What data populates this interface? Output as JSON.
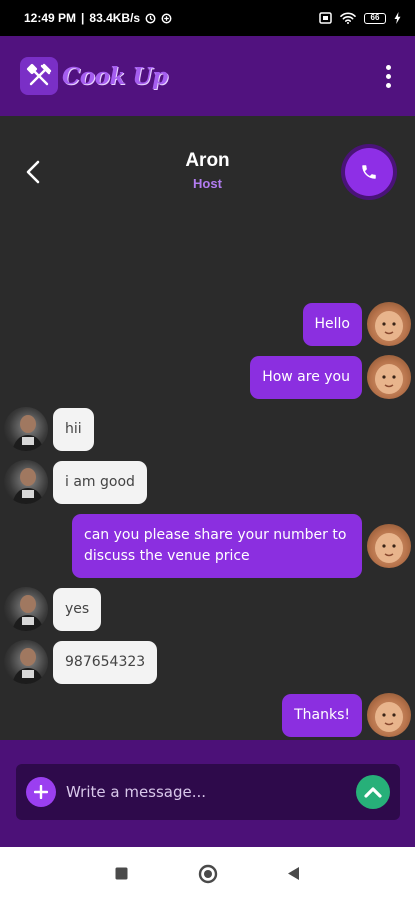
{
  "status_bar": {
    "time": "12:49 PM",
    "speed": "83.4KB/s",
    "battery": "66"
  },
  "app_bar": {
    "brand_name": "Cook Up",
    "menu_icon": "kebab-menu-icon"
  },
  "chat_header": {
    "contact_name": "Aron",
    "contact_role": "Host",
    "back_icon": "chevron-left-icon",
    "call_icon": "phone-icon"
  },
  "messages": [
    {
      "direction": "out",
      "text": "Hello"
    },
    {
      "direction": "out",
      "text": "How are you"
    },
    {
      "direction": "in",
      "text": "hii"
    },
    {
      "direction": "in",
      "text": "i am good"
    },
    {
      "direction": "out",
      "text": "can you please share your number to discuss the venue price"
    },
    {
      "direction": "in",
      "text": "yes"
    },
    {
      "direction": "in",
      "text": "987654323"
    },
    {
      "direction": "out",
      "text": "Thanks!"
    }
  ],
  "composer": {
    "placeholder": "Write a message...",
    "add_icon": "plus-icon",
    "send_icon": "chevron-up-icon"
  },
  "colors": {
    "app_bar": "#51127f",
    "background": "#2b2b2b",
    "outgoing_bubble": "#8b2fe0",
    "incoming_bubble": "#f3f3f3",
    "send_button": "#27b079"
  }
}
